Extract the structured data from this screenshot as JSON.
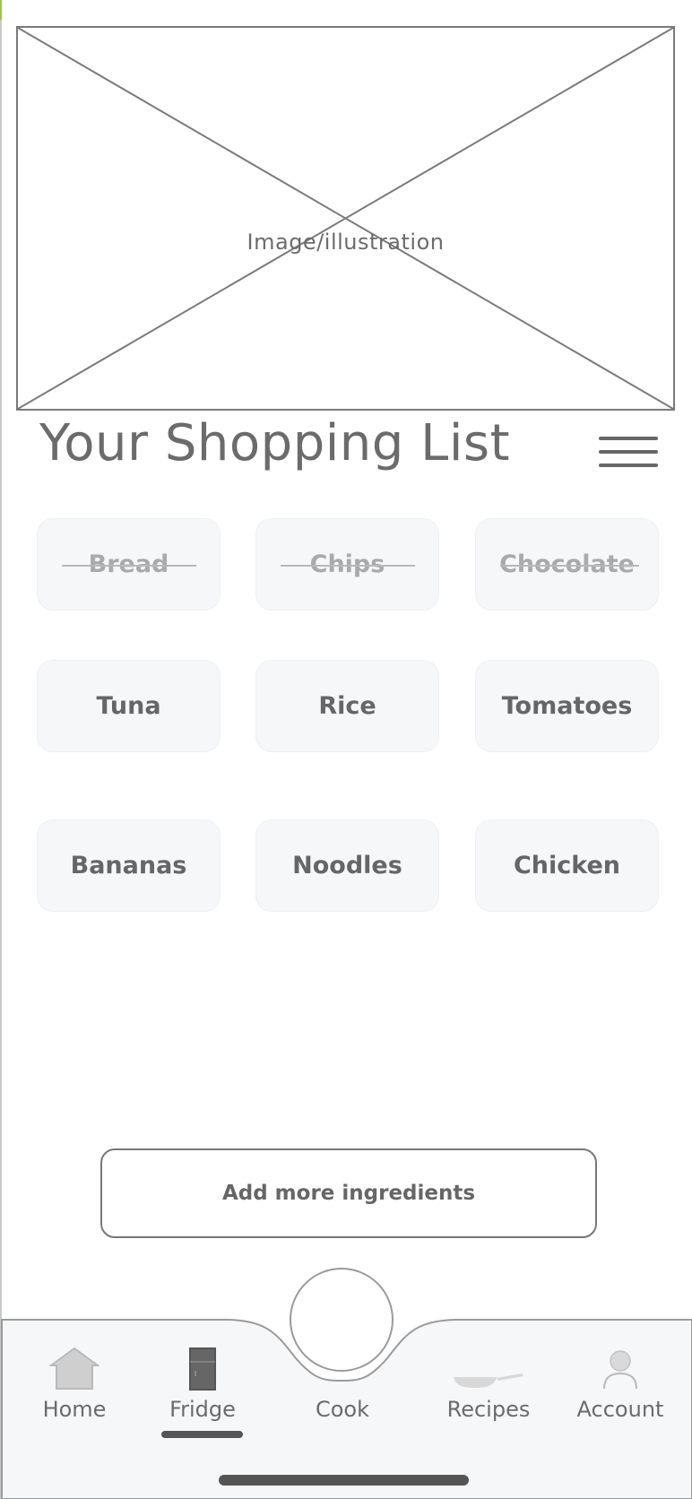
{
  "hero": {
    "label": "Image/illustration"
  },
  "header": {
    "title": "Your Shopping List"
  },
  "items": [
    {
      "name": "Bread",
      "checked": true
    },
    {
      "name": "Chips",
      "checked": true
    },
    {
      "name": "Chocolate",
      "checked": true
    },
    {
      "name": "Tuna",
      "checked": false
    },
    {
      "name": "Rice",
      "checked": false
    },
    {
      "name": "Tomatoes",
      "checked": false
    },
    {
      "name": "Bananas",
      "checked": false
    },
    {
      "name": "Noodles",
      "checked": false
    },
    {
      "name": "Chicken",
      "checked": false
    }
  ],
  "actions": {
    "add_label": "Add more ingredients"
  },
  "nav": {
    "active": "Fridge",
    "items": [
      {
        "label": "Home",
        "icon": "house-icon"
      },
      {
        "label": "Fridge",
        "icon": "fridge-icon"
      },
      {
        "label": "Cook",
        "icon": "cook-circle"
      },
      {
        "label": "Recipes",
        "icon": "frying-pan-icon"
      },
      {
        "label": "Account",
        "icon": "person-icon"
      }
    ]
  },
  "colors": {
    "text": "#666666",
    "chip_bg": "#f6f7f9",
    "nav_bg": "#f6f7f9",
    "accent": "#555555"
  }
}
